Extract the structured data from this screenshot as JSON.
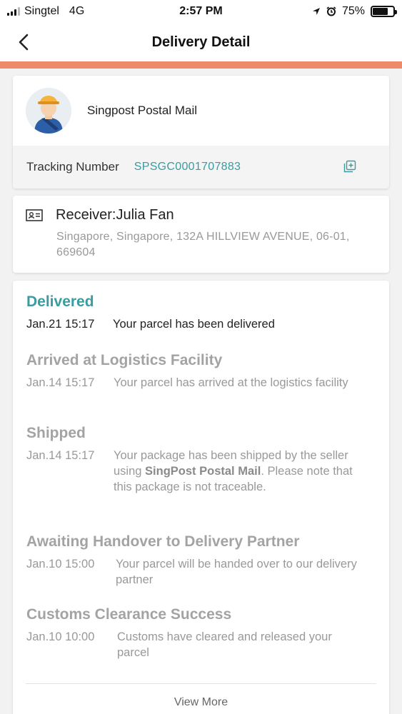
{
  "status_bar": {
    "carrier": "Singtel",
    "network": "4G",
    "time": "2:57 PM",
    "battery_percent_label": "75%",
    "battery_level": 0.75
  },
  "header": {
    "title": "Delivery Detail",
    "accent_color": "#ee8a67"
  },
  "carrier_card": {
    "name": "Singpost Postal Mail",
    "tracking_label": "Tracking Number",
    "tracking_number": "SPSGC0001707883",
    "tracking_color": "#3a9ba0"
  },
  "receiver": {
    "name": "Receiver:Julia Fan",
    "address": "Singapore, Singapore, 132A HILLVIEW AVENUE, 06-01, 669604"
  },
  "timeline": {
    "events": [
      {
        "status": "Delivered",
        "time": "Jan.21 15:17",
        "description": "Your parcel has been delivered"
      },
      {
        "status": "Arrived at Logistics Facility",
        "time": "Jan.14 15:17",
        "description": "Your parcel has arrived at the logistics facility"
      },
      {
        "status": "Shipped",
        "time": "Jan.14 15:17",
        "description_before": "Your package has been shipped by the seller using ",
        "description_bold": "SingPost Postal Mail",
        "description_after": ". Please note that this package is not traceable."
      },
      {
        "status": "Awaiting Handover to Delivery Partner",
        "time": "Jan.10 15:00",
        "description": "Your parcel will be handed over to our delivery partner"
      },
      {
        "status": "Customs Clearance Success",
        "time": "Jan.10 10:00",
        "description": "Customs have cleared and released your parcel"
      }
    ],
    "view_more_label": "View More"
  }
}
